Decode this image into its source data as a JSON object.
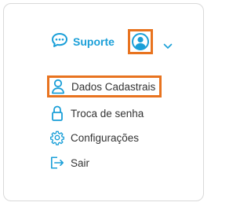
{
  "colors": {
    "accent": "#1a9fd8",
    "highlight": "#e8731f",
    "text": "#333333"
  },
  "header": {
    "support_label": "Suporte",
    "support_icon": "chat-bubble-icon",
    "avatar_icon": "user-avatar-icon",
    "dropdown_icon": "chevron-down-icon"
  },
  "menu": {
    "items": [
      {
        "label": "Dados Cadastrais",
        "icon": "user-icon"
      },
      {
        "label": "Troca de senha",
        "icon": "lock-icon"
      },
      {
        "label": "Configurações",
        "icon": "gear-icon"
      },
      {
        "label": "Sair",
        "icon": "logout-icon"
      }
    ]
  }
}
